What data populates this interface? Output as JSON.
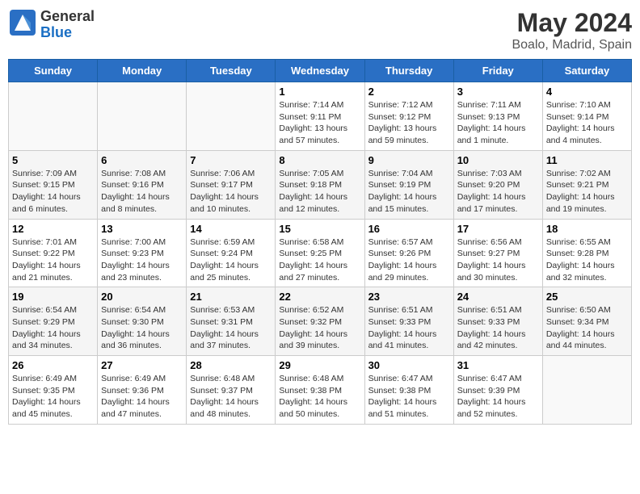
{
  "logo": {
    "general": "General",
    "blue": "Blue"
  },
  "title": "May 2024",
  "subtitle": "Boalo, Madrid, Spain",
  "days": [
    "Sunday",
    "Monday",
    "Tuesday",
    "Wednesday",
    "Thursday",
    "Friday",
    "Saturday"
  ],
  "weeks": [
    [
      {
        "num": "",
        "content": ""
      },
      {
        "num": "",
        "content": ""
      },
      {
        "num": "",
        "content": ""
      },
      {
        "num": "1",
        "content": "Sunrise: 7:14 AM\nSunset: 9:11 PM\nDaylight: 13 hours and 57 minutes."
      },
      {
        "num": "2",
        "content": "Sunrise: 7:12 AM\nSunset: 9:12 PM\nDaylight: 13 hours and 59 minutes."
      },
      {
        "num": "3",
        "content": "Sunrise: 7:11 AM\nSunset: 9:13 PM\nDaylight: 14 hours and 1 minute."
      },
      {
        "num": "4",
        "content": "Sunrise: 7:10 AM\nSunset: 9:14 PM\nDaylight: 14 hours and 4 minutes."
      }
    ],
    [
      {
        "num": "5",
        "content": "Sunrise: 7:09 AM\nSunset: 9:15 PM\nDaylight: 14 hours and 6 minutes."
      },
      {
        "num": "6",
        "content": "Sunrise: 7:08 AM\nSunset: 9:16 PM\nDaylight: 14 hours and 8 minutes."
      },
      {
        "num": "7",
        "content": "Sunrise: 7:06 AM\nSunset: 9:17 PM\nDaylight: 14 hours and 10 minutes."
      },
      {
        "num": "8",
        "content": "Sunrise: 7:05 AM\nSunset: 9:18 PM\nDaylight: 14 hours and 12 minutes."
      },
      {
        "num": "9",
        "content": "Sunrise: 7:04 AM\nSunset: 9:19 PM\nDaylight: 14 hours and 15 minutes."
      },
      {
        "num": "10",
        "content": "Sunrise: 7:03 AM\nSunset: 9:20 PM\nDaylight: 14 hours and 17 minutes."
      },
      {
        "num": "11",
        "content": "Sunrise: 7:02 AM\nSunset: 9:21 PM\nDaylight: 14 hours and 19 minutes."
      }
    ],
    [
      {
        "num": "12",
        "content": "Sunrise: 7:01 AM\nSunset: 9:22 PM\nDaylight: 14 hours and 21 minutes."
      },
      {
        "num": "13",
        "content": "Sunrise: 7:00 AM\nSunset: 9:23 PM\nDaylight: 14 hours and 23 minutes."
      },
      {
        "num": "14",
        "content": "Sunrise: 6:59 AM\nSunset: 9:24 PM\nDaylight: 14 hours and 25 minutes."
      },
      {
        "num": "15",
        "content": "Sunrise: 6:58 AM\nSunset: 9:25 PM\nDaylight: 14 hours and 27 minutes."
      },
      {
        "num": "16",
        "content": "Sunrise: 6:57 AM\nSunset: 9:26 PM\nDaylight: 14 hours and 29 minutes."
      },
      {
        "num": "17",
        "content": "Sunrise: 6:56 AM\nSunset: 9:27 PM\nDaylight: 14 hours and 30 minutes."
      },
      {
        "num": "18",
        "content": "Sunrise: 6:55 AM\nSunset: 9:28 PM\nDaylight: 14 hours and 32 minutes."
      }
    ],
    [
      {
        "num": "19",
        "content": "Sunrise: 6:54 AM\nSunset: 9:29 PM\nDaylight: 14 hours and 34 minutes."
      },
      {
        "num": "20",
        "content": "Sunrise: 6:54 AM\nSunset: 9:30 PM\nDaylight: 14 hours and 36 minutes."
      },
      {
        "num": "21",
        "content": "Sunrise: 6:53 AM\nSunset: 9:31 PM\nDaylight: 14 hours and 37 minutes."
      },
      {
        "num": "22",
        "content": "Sunrise: 6:52 AM\nSunset: 9:32 PM\nDaylight: 14 hours and 39 minutes."
      },
      {
        "num": "23",
        "content": "Sunrise: 6:51 AM\nSunset: 9:33 PM\nDaylight: 14 hours and 41 minutes."
      },
      {
        "num": "24",
        "content": "Sunrise: 6:51 AM\nSunset: 9:33 PM\nDaylight: 14 hours and 42 minutes."
      },
      {
        "num": "25",
        "content": "Sunrise: 6:50 AM\nSunset: 9:34 PM\nDaylight: 14 hours and 44 minutes."
      }
    ],
    [
      {
        "num": "26",
        "content": "Sunrise: 6:49 AM\nSunset: 9:35 PM\nDaylight: 14 hours and 45 minutes."
      },
      {
        "num": "27",
        "content": "Sunrise: 6:49 AM\nSunset: 9:36 PM\nDaylight: 14 hours and 47 minutes."
      },
      {
        "num": "28",
        "content": "Sunrise: 6:48 AM\nSunset: 9:37 PM\nDaylight: 14 hours and 48 minutes."
      },
      {
        "num": "29",
        "content": "Sunrise: 6:48 AM\nSunset: 9:38 PM\nDaylight: 14 hours and 50 minutes."
      },
      {
        "num": "30",
        "content": "Sunrise: 6:47 AM\nSunset: 9:38 PM\nDaylight: 14 hours and 51 minutes."
      },
      {
        "num": "31",
        "content": "Sunrise: 6:47 AM\nSunset: 9:39 PM\nDaylight: 14 hours and 52 minutes."
      },
      {
        "num": "",
        "content": ""
      }
    ]
  ]
}
